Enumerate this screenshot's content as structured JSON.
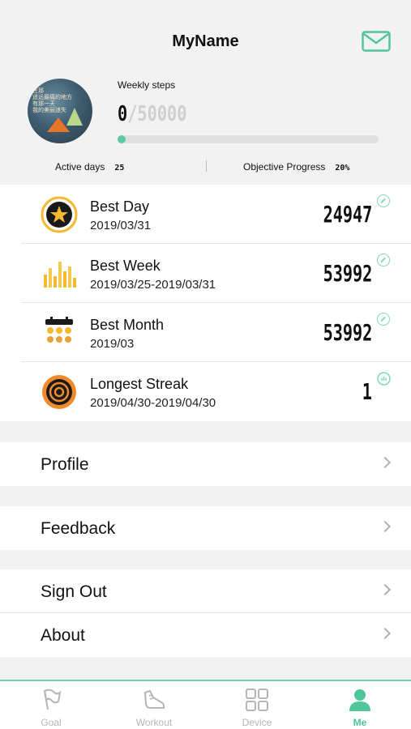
{
  "header": {
    "title": "MyName",
    "avatar_text": "在那\n遥远最痛的地方\n有那一天\n我的美丽迷失"
  },
  "weekly": {
    "label": "Weekly steps",
    "current": "0",
    "goal": "/50000",
    "progress_fraction": 0.0
  },
  "stats": {
    "active_days_label": "Active days",
    "active_days_value": "25",
    "objective_label": "Objective Progress",
    "objective_value": "20%"
  },
  "records": [
    {
      "name": "Best Day",
      "date": "2019/03/31",
      "value": "24947",
      "icon": "star-medal-icon",
      "badge": "compass-icon"
    },
    {
      "name": "Best Week",
      "date": "2019/03/25-2019/03/31",
      "value": "53992",
      "icon": "bar-chart-icon",
      "badge": "compass-icon"
    },
    {
      "name": "Best Month",
      "date": "2019/03",
      "value": "53992",
      "icon": "calendar-icon",
      "badge": "compass-icon"
    },
    {
      "name": "Longest Streak",
      "date": "2019/04/30-2019/04/30",
      "value": "1",
      "icon": "target-icon",
      "badge": "chart-icon"
    }
  ],
  "menu": {
    "profile": "Profile",
    "feedback": "Feedback",
    "sign_out": "Sign Out",
    "about": "About"
  },
  "tabs": [
    {
      "label": "Goal",
      "icon": "flag-icon"
    },
    {
      "label": "Workout",
      "icon": "shoe-icon"
    },
    {
      "label": "Device",
      "icon": "grid-icon"
    },
    {
      "label": "Me",
      "icon": "person-icon",
      "active": true
    }
  ],
  "colors": {
    "accent": "#5fc9a5",
    "tab_active": "#4fc59a",
    "medal_gold": "#f5b931"
  }
}
